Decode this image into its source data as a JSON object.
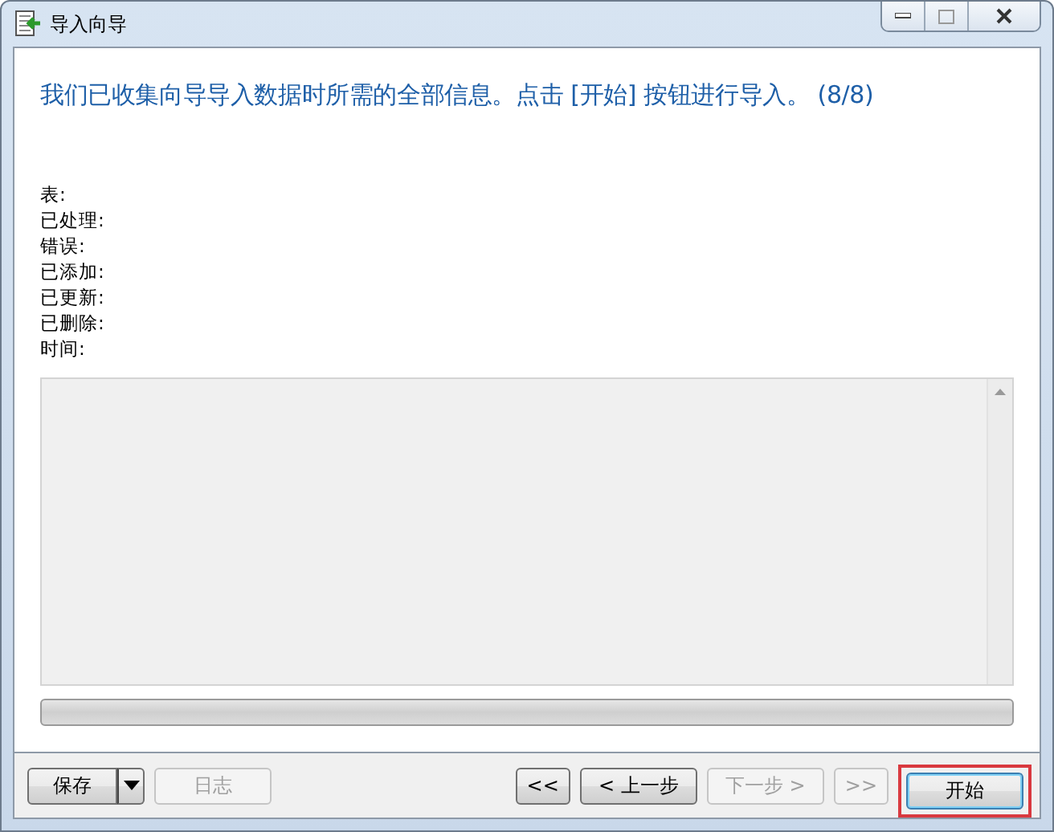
{
  "window": {
    "title": "导入向导"
  },
  "heading": "我们已收集向导导入数据时所需的全部信息。点击 [开始] 按钮进行导入。 (8/8)",
  "summary_labels": [
    "表:",
    "已处理:",
    "错误:",
    "已添加:",
    "已更新:",
    "已删除:",
    "时间:"
  ],
  "progress": {
    "level": 0
  },
  "buttons": [
    {
      "kind": "split",
      "label": "保存",
      "disabled": false
    },
    {
      "kind": "plain",
      "label": "日志",
      "disabled": true
    },
    {
      "kind": "small",
      "label": "<<",
      "disabled": false
    },
    {
      "kind": "plain",
      "label": "< 上一步",
      "disabled": false
    },
    {
      "kind": "plain",
      "label": "下一步 >",
      "disabled": true
    },
    {
      "kind": "small",
      "label": ">>",
      "disabled": true
    },
    {
      "kind": "default",
      "label": "开始",
      "disabled": false
    }
  ]
}
